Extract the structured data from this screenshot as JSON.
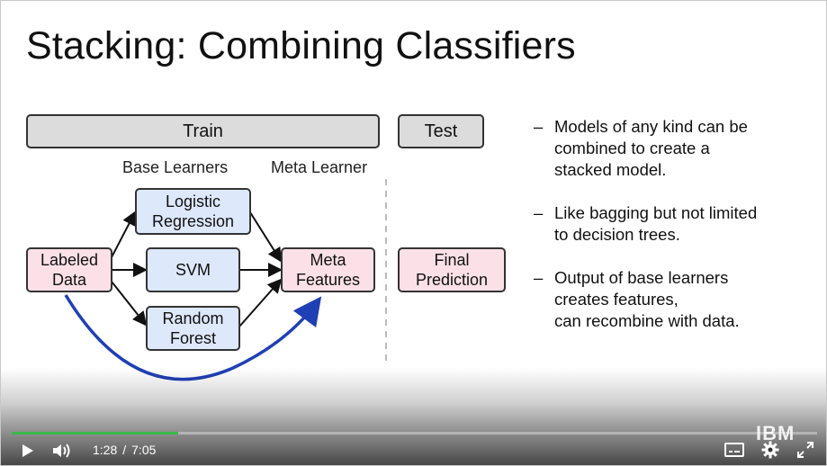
{
  "slide": {
    "title": "Stacking: Combining Classifiers",
    "train_label": "Train",
    "test_label": "Test",
    "base_learners_label": "Base Learners",
    "meta_learner_label": "Meta Learner",
    "nodes": {
      "labeled_data": "Labeled\nData",
      "logistic_regression": "Logistic\nRegression",
      "svm": "SVM",
      "random_forest": "Random\nForest",
      "meta_features": "Meta\nFeatures",
      "final_prediction": "Final\nPrediction"
    },
    "bullets": [
      "Models of any kind can be\ncombined to create a\nstacked model.",
      "Like bagging but not limited\nto decision trees.",
      "Output of base learners\ncreates features,\ncan recombine with data."
    ],
    "colors": {
      "data_box": "#fbe0e8",
      "model_box": "#dde8fb",
      "recombine_arrow": "#1f3fb5"
    }
  },
  "player": {
    "current_time": "1:28",
    "separator": "/",
    "duration": "7:05",
    "progress_fraction": 0.207,
    "brand_logo": "IBM",
    "icons": [
      "play-icon",
      "volume-icon",
      "captions-icon",
      "settings-gear-icon",
      "fullscreen-icon"
    ]
  }
}
